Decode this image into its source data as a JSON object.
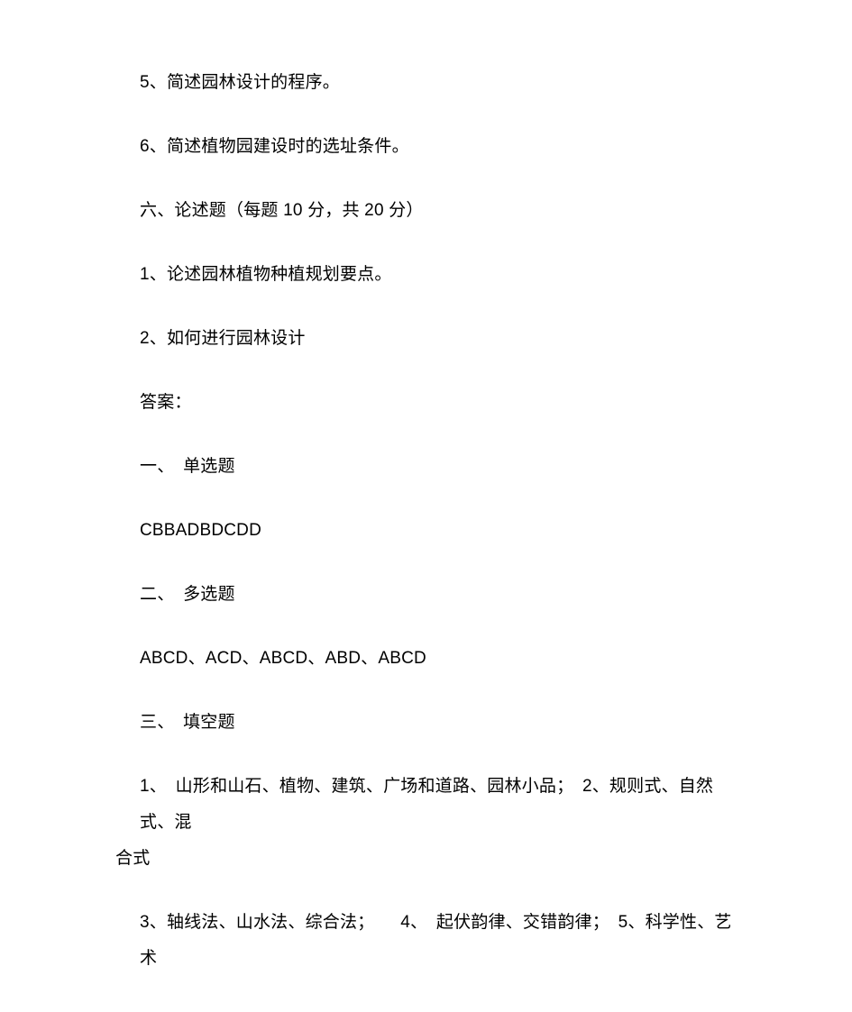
{
  "document": {
    "background_color": "#ffffff",
    "text_color": "#000000",
    "paragraphs": [
      {
        "id": "q5-short-answer",
        "text": "5、简述园林设计的程序。"
      },
      {
        "id": "q6-short-answer",
        "text": "6、简述植物园建设时的选址条件。"
      },
      {
        "id": "section-six-heading",
        "text": "六、论述题（每题 10 分，共 20 分）"
      },
      {
        "id": "essay-q1",
        "text": "1、论述园林植物种植规划要点。"
      },
      {
        "id": "essay-q2",
        "text": "2、如何进行园林设计"
      },
      {
        "id": "answers-label",
        "text": "答案："
      },
      {
        "id": "answer-section-1-heading",
        "text": "一、　单选题"
      },
      {
        "id": "answer-single-choice",
        "text": "CBBADBDCDD"
      },
      {
        "id": "answer-section-2-heading",
        "text": "二、　多选题"
      },
      {
        "id": "answer-multi-choice",
        "text": "ABCD、ACD、ABCD、ABD、ABCD"
      },
      {
        "id": "answer-section-3-heading",
        "text": "三、　填空题"
      },
      {
        "id": "answer-fill-blank-1",
        "text": "1、　山形和山石、植物、建筑、广场和道路、园林小品；　2、规则式、自然式、混",
        "runon": "合式",
        "wraps": true
      },
      {
        "id": "answer-fill-blank-2",
        "text": "3、轴线法、山水法、综合法；　　4、　起伏韵律、交错韵律；　5、科学性、艺术"
      }
    ]
  }
}
